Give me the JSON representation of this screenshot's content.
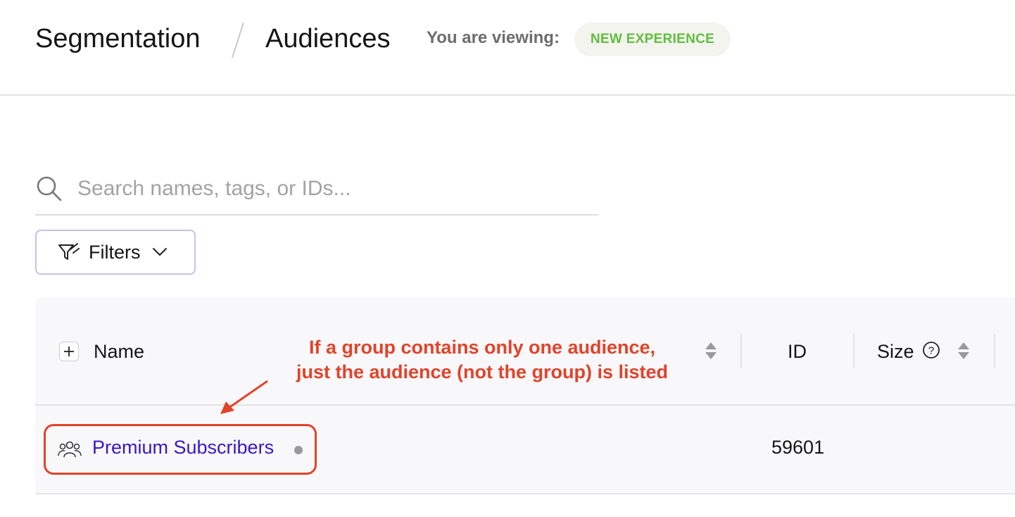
{
  "header": {
    "breadcrumb": [
      "Segmentation",
      "Audiences"
    ],
    "viewing_label": "You are viewing:",
    "badge": "NEW EXPERIENCE"
  },
  "search": {
    "value": "",
    "placeholder": "Search names, tags, or IDs..."
  },
  "filters": {
    "label": "Filters"
  },
  "table": {
    "columns": [
      "Name",
      "ID",
      "Size"
    ],
    "rows": [
      {
        "name": "Premium Subscribers",
        "id": "59601",
        "size": ""
      }
    ]
  },
  "annotation": {
    "lines": [
      "If a group contains only one audience,",
      "just the audience (not the group) is listed"
    ]
  },
  "colors": {
    "annotation": "#e2432a",
    "badge_text": "#5fbe3c",
    "link": "#3a16c8",
    "filters_border": "#c7c1ea"
  },
  "icons": [
    "search-icon",
    "filter-icon",
    "chevron-down-icon",
    "plus-icon",
    "sort-icon",
    "help-circle-icon",
    "people-icon"
  ]
}
